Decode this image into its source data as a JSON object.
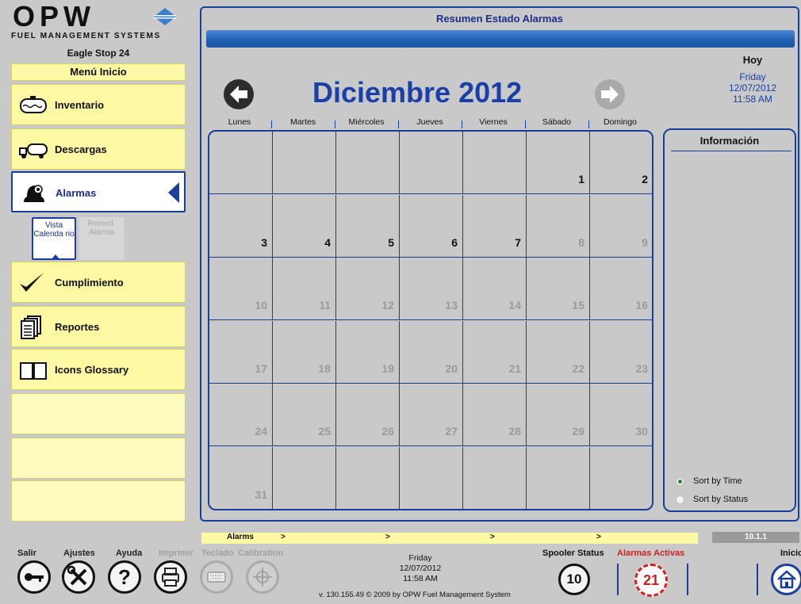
{
  "brand": {
    "name": "OPW",
    "subtitle": "FUEL MANAGEMENT SYSTEMS",
    "site": "Eagle Stop 24"
  },
  "menu": {
    "header": "Menú Inicio",
    "items": [
      {
        "label": "Inventario",
        "icon": "tank-icon"
      },
      {
        "label": "Descargas",
        "icon": "truck-icon"
      },
      {
        "label": "Alarmas",
        "icon": "bell-icon",
        "active": true
      },
      {
        "label": "Cumplimiento",
        "icon": "checkmark-icon"
      },
      {
        "label": "Reportes",
        "icon": "documents-icon"
      },
      {
        "label": "Icons Glossary",
        "icon": "book-icon"
      }
    ],
    "subtabs": [
      {
        "label": "Vista Calenda rio",
        "active": true
      },
      {
        "label": "Remed. Alarma",
        "active": false
      }
    ]
  },
  "main": {
    "title": "Resumen Estado Alarmas",
    "month": "Diciembre 2012",
    "today": {
      "label": "Hoy",
      "day": "Friday",
      "date": "12/07/2012",
      "time": "11:58 AM"
    },
    "weekdays": [
      "Lunes",
      "Martes",
      "Miércoles",
      "Jueves",
      "Viernes",
      "Sábado",
      "Domingo"
    ],
    "calendar": [
      [
        "",
        "",
        "",
        "",
        "",
        "1",
        "2"
      ],
      [
        "3",
        "4",
        "5",
        "6",
        "7",
        "8",
        "9"
      ],
      [
        "10",
        "11",
        "12",
        "13",
        "14",
        "15",
        "16"
      ],
      [
        "17",
        "18",
        "19",
        "20",
        "21",
        "22",
        "23"
      ],
      [
        "24",
        "25",
        "26",
        "27",
        "28",
        "29",
        "30"
      ],
      [
        "31",
        "",
        "",
        "",
        "",
        "",
        ""
      ]
    ],
    "current_until": 7,
    "info": {
      "title": "Información",
      "sort_options": [
        {
          "label": "Sort by Time",
          "selected": true
        },
        {
          "label": "Sort by Status",
          "selected": false
        }
      ]
    }
  },
  "footer": {
    "strip": [
      "Alarms",
      ">",
      ">",
      ">",
      ">"
    ],
    "version_box": "10.1.1",
    "tools": [
      {
        "label": "Salir",
        "icon": "key-icon",
        "enabled": true
      },
      {
        "label": "Ajustes",
        "icon": "tools-icon",
        "enabled": true
      },
      {
        "label": "Ayuda",
        "icon": "question-icon",
        "enabled": true
      },
      {
        "label": "Imprimir",
        "icon": "printer-icon",
        "enabled": false
      },
      {
        "label": "Teclado",
        "icon": "keyboard-icon",
        "enabled": false
      },
      {
        "label": "Calibration",
        "icon": "crosshair-icon",
        "enabled": false
      }
    ],
    "day": "Friday",
    "date": "12/07/2012",
    "time": "11:58 AM",
    "version": "v. 130.155.49   © 2009 by OPW Fuel Management System",
    "spooler_label": "Spooler Status",
    "spooler_count": "10",
    "alarms_label": "Alarmas Activas",
    "alarms_count": "21",
    "home_label": "Inicio"
  }
}
